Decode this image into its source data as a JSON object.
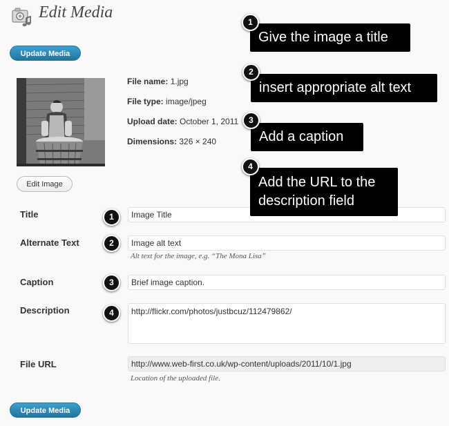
{
  "header": {
    "title": "Edit Media",
    "icon": "media-camera-icon"
  },
  "buttons": {
    "update_top": "Update Media",
    "update_bottom": "Update Media",
    "edit_image": "Edit Image"
  },
  "file_info": {
    "name_label": "File name:",
    "name_value": "1.jpg",
    "type_label": "File type:",
    "type_value": "image/jpeg",
    "upload_label": "Upload date:",
    "upload_value": "October 1, 2011",
    "dimensions_label": "Dimensions:",
    "dimensions_value": "326 × 240"
  },
  "fields": {
    "title": {
      "label": "Title",
      "value": "Image Title"
    },
    "alt": {
      "label": "Alternate Text",
      "value": "Image alt text",
      "help": "Alt text for the image, e.g. “The Mona Lisa”"
    },
    "caption": {
      "label": "Caption",
      "value": "Brief image caption."
    },
    "description": {
      "label": "Description",
      "value": "http://flickr.com/photos/justbcuz/112479862/"
    },
    "file_url": {
      "label": "File URL",
      "value": "http://www.web-first.co.uk/wp-content/uploads/2011/10/1.jpg",
      "help": "Location of the uploaded file."
    }
  },
  "callouts": [
    {
      "number": "1",
      "text": "Give the image a title"
    },
    {
      "number": "2",
      "text": "insert appropriate alt text"
    },
    {
      "number": "3",
      "text": "Add a caption"
    },
    {
      "number": "4",
      "text_line1": "Add the URL to the",
      "text_line2": "description field"
    }
  ],
  "badges": [
    "1",
    "2",
    "3",
    "4"
  ],
  "colors": {
    "primary_button": "#21759b",
    "background": "#f9f9f9",
    "callout_bg": "#000000"
  }
}
